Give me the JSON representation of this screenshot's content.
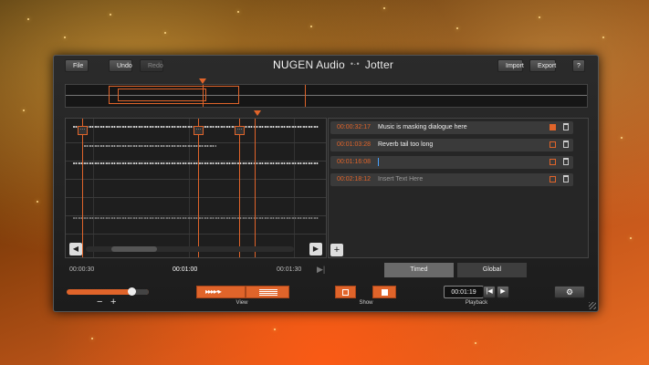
{
  "toolbar": {
    "file_label": "File",
    "undo_label": "Undo",
    "redo_label": "Redo",
    "import_label": "Import",
    "export_label": "Export",
    "help_label": "?"
  },
  "brand": {
    "nu": "NU",
    "gen_audio": "GEN Audio",
    "product": "Jotter"
  },
  "timeline": {
    "labels": [
      "00:00:30",
      "00:01:00",
      "00:01:30"
    ]
  },
  "notes": [
    {
      "time": "00:00:32:17",
      "text": "Music is masking dialogue here",
      "checked": true
    },
    {
      "time": "00:01:03:28",
      "text": "Reverb tail too long",
      "checked": false
    },
    {
      "time": "00:01:16:08",
      "text": "",
      "checked": false
    },
    {
      "time": "00:02:18:12",
      "text": "Insert Text Here",
      "checked": false,
      "placeholder": true
    }
  ],
  "tabs": {
    "timed": "Timed",
    "global": "Global"
  },
  "controls": {
    "volume_level": 0.8,
    "minus": "−",
    "plus": "+",
    "view_label": "View",
    "show_label": "Show",
    "playback_label": "Playback",
    "playback_time": "00:01:19"
  },
  "colors": {
    "accent": "#e0642a"
  }
}
